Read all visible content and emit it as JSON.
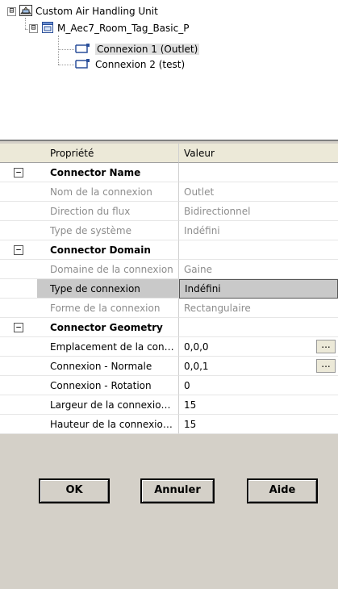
{
  "tree": {
    "root_label": "Custom Air Handling Unit",
    "family_label": "M_Aec7_Room_Tag_Basic_P",
    "connectors": [
      {
        "label": "Connexion 1 (Outlet)",
        "selected": true
      },
      {
        "label": "Connexion 2 (test)",
        "selected": false
      }
    ],
    "expander_symbol": "⊟"
  },
  "grid": {
    "header": {
      "property": "Propriété",
      "value": "Valeur"
    },
    "sections": [
      {
        "label": "Connector Name"
      },
      {
        "label": "Connector Domain"
      },
      {
        "label": "Connector Geometry"
      }
    ],
    "rows": [
      {
        "property": "Nom de la connexion",
        "value": "Outlet"
      },
      {
        "property": "Direction du flux",
        "value": "Bidirectionnel"
      },
      {
        "property": "Type de système",
        "value": "Indéfini"
      },
      {
        "property": "Domaine de la connexion",
        "value": "Gaine"
      },
      {
        "property": "Type de connexion",
        "value": "Indéfini"
      },
      {
        "property": "Forme de la connexion",
        "value": "Rectangulaire"
      },
      {
        "property": "Emplacement de la con…",
        "value": "0,0,0",
        "button": "..."
      },
      {
        "property": "Connexion - Normale",
        "value": "0,0,1",
        "button": "..."
      },
      {
        "property": "Connexion - Rotation",
        "value": "0"
      },
      {
        "property": "Largeur de la connexio…",
        "value": "15"
      },
      {
        "property": "Hauteur de la connexio…",
        "value": "15"
      }
    ]
  },
  "buttons": {
    "ok": "OK",
    "cancel": "Annuler",
    "help": "Aide"
  }
}
